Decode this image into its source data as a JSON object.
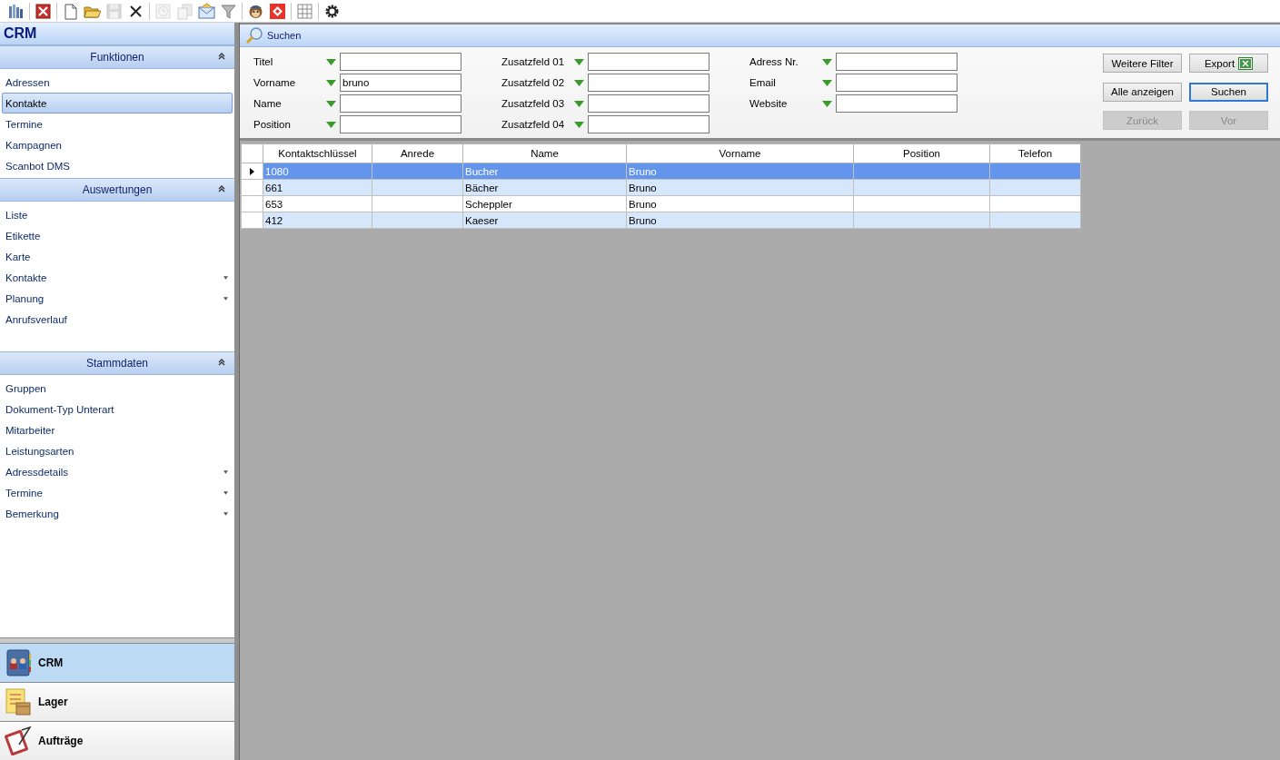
{
  "toolbar": {
    "groups": [
      [
        {
          "kind": "books",
          "disabled": false
        }
      ],
      [
        {
          "kind": "close",
          "disabled": false
        }
      ],
      [
        {
          "kind": "new",
          "disabled": false
        },
        {
          "kind": "open",
          "disabled": false
        },
        {
          "kind": "save",
          "disabled": true
        },
        {
          "kind": "delete",
          "disabled": false
        }
      ],
      [
        {
          "kind": "clock",
          "disabled": true
        },
        {
          "kind": "docs",
          "disabled": true
        },
        {
          "kind": "mail",
          "disabled": false
        },
        {
          "kind": "filter",
          "disabled": false
        }
      ],
      [
        {
          "kind": "monkey",
          "disabled": false
        },
        {
          "kind": "diamond",
          "disabled": false
        }
      ],
      [
        {
          "kind": "grid",
          "disabled": false
        }
      ],
      [
        {
          "kind": "gear",
          "disabled": false
        }
      ]
    ]
  },
  "sidebar": {
    "title": "CRM",
    "sections": [
      {
        "title": "Funktionen",
        "expanded": true,
        "items": [
          {
            "label": "Adressen",
            "selected": false,
            "has_menu": false
          },
          {
            "label": "Kontakte",
            "selected": true,
            "has_menu": false
          },
          {
            "label": "Termine",
            "selected": false,
            "has_menu": false
          },
          {
            "label": "Kampagnen",
            "selected": false,
            "has_menu": false
          },
          {
            "label": "Scanbot DMS",
            "selected": false,
            "has_menu": false
          }
        ]
      },
      {
        "title": "Auswertungen",
        "expanded": true,
        "items": [
          {
            "label": "Liste",
            "selected": false,
            "has_menu": false
          },
          {
            "label": "Etikette",
            "selected": false,
            "has_menu": false
          },
          {
            "label": "Karte",
            "selected": false,
            "has_menu": false
          },
          {
            "label": "Kontakte",
            "selected": false,
            "has_menu": true
          },
          {
            "label": "Planung",
            "selected": false,
            "has_menu": true
          },
          {
            "label": "Anrufsverlauf",
            "selected": false,
            "has_menu": false
          }
        ]
      },
      {
        "title": "Stammdaten",
        "expanded": true,
        "items": [
          {
            "label": "Gruppen",
            "selected": false,
            "has_menu": false
          },
          {
            "label": "Dokument-Typ Unterart",
            "selected": false,
            "has_menu": false
          },
          {
            "label": "Mitarbeiter",
            "selected": false,
            "has_menu": false
          },
          {
            "label": "Leistungsarten",
            "selected": false,
            "has_menu": false
          },
          {
            "label": "Adressdetails",
            "selected": false,
            "has_menu": true
          },
          {
            "label": "Termine",
            "selected": false,
            "has_menu": true
          },
          {
            "label": "Bemerkung",
            "selected": false,
            "has_menu": true
          }
        ]
      }
    ],
    "modules": [
      {
        "kind": "crm",
        "label": "CRM",
        "selected": true
      },
      {
        "kind": "lager",
        "label": "Lager",
        "selected": false
      },
      {
        "kind": "auftraege",
        "label": "Aufträge",
        "selected": false
      }
    ]
  },
  "search": {
    "title": "Suchen",
    "field_columns": [
      [
        {
          "label": "Titel"
        },
        {
          "label": "Vorname",
          "value": "bruno"
        },
        {
          "label": "Name"
        },
        {
          "label": "Position"
        }
      ],
      [
        {
          "label": "Zusatzfeld 01"
        },
        {
          "label": "Zusatzfeld 02"
        },
        {
          "label": "Zusatzfeld 03"
        },
        {
          "label": "Zusatzfeld 04"
        }
      ],
      [
        {
          "label": "Adress Nr."
        },
        {
          "label": "Email"
        },
        {
          "label": "Website"
        }
      ]
    ],
    "buttons": [
      {
        "kind": "plain",
        "label": "Weitere Filter",
        "disabled": false,
        "focused": false
      },
      {
        "kind": "excel",
        "label": "Export",
        "disabled": false,
        "focused": false
      },
      {
        "kind": "plain",
        "label": "Alle anzeigen",
        "disabled": false,
        "focused": false
      },
      {
        "kind": "plain",
        "label": "Suchen",
        "disabled": false,
        "focused": true
      },
      {
        "kind": "plain",
        "label": "Zurück",
        "disabled": true,
        "focused": false
      },
      {
        "kind": "plain",
        "label": "Vor",
        "disabled": true,
        "focused": false
      }
    ]
  },
  "table": {
    "columns": [
      "Kontaktschlüssel",
      "Anrede",
      "Name",
      "Vorname",
      "Position",
      "Telefon"
    ],
    "rows": [
      {
        "selected": true,
        "cells": [
          "1080",
          null,
          "Bucher",
          "Bruno",
          null,
          null
        ]
      },
      {
        "selected": false,
        "cells": [
          "661",
          null,
          "Bächer",
          "Bruno",
          null,
          null
        ]
      },
      {
        "selected": false,
        "cells": [
          "653",
          null,
          "Scheppler",
          "Bruno",
          null,
          null
        ]
      },
      {
        "selected": false,
        "cells": [
          "412",
          null,
          "Kaeser",
          "Bruno",
          null,
          null
        ]
      }
    ]
  }
}
